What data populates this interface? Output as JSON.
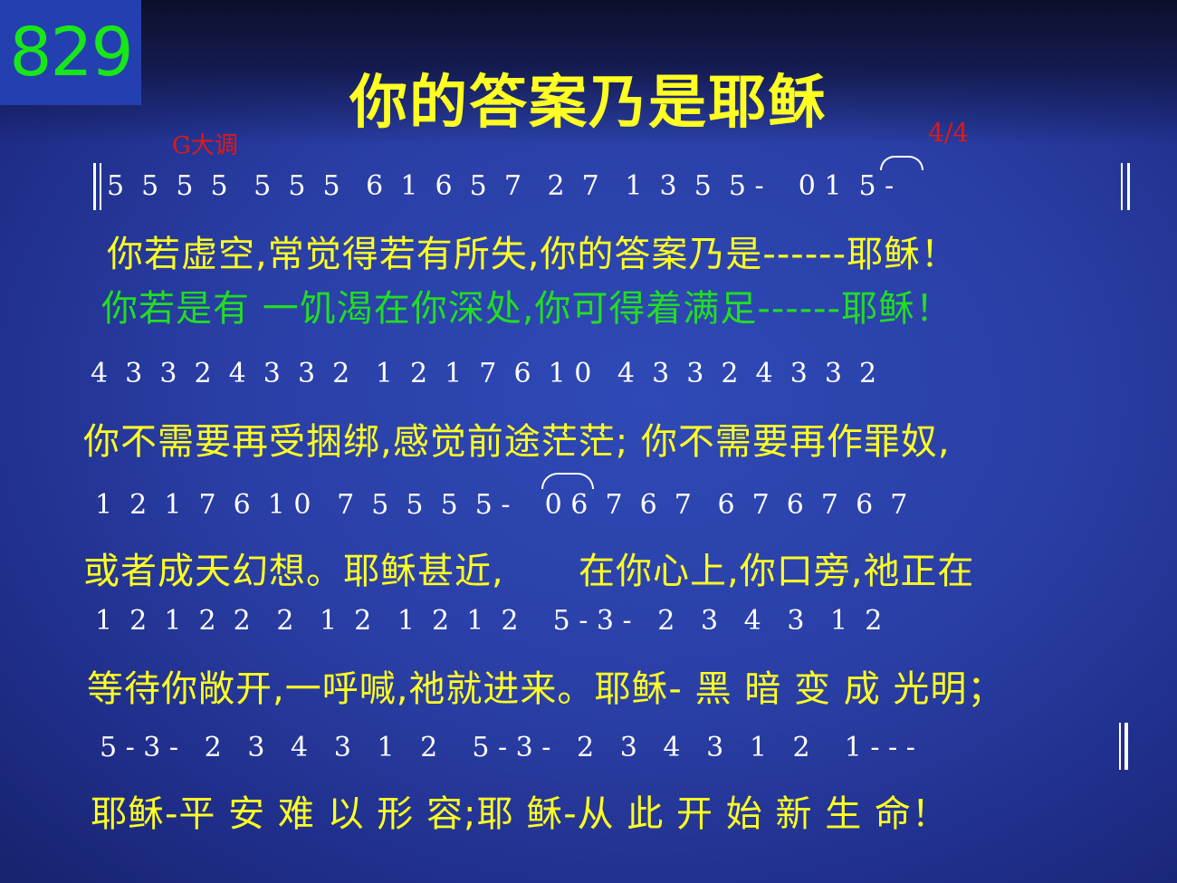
{
  "hymn_number": "829",
  "title": "你的答案乃是耶稣",
  "key": "G大调",
  "meter": "4/4",
  "lines": [
    {
      "notes": "5  5  5  5   5  5  5   6  1  6  5  7   2  7   1  3  5  5 -    0 1  5 -",
      "lyrics1": "你若虚空,常觉得若有所失,你的答案乃是------耶稣！",
      "lyrics2": "你若是有 一饥渴在你深处,你可得着满足------耶稣！"
    },
    {
      "notes": "4  3  3  2  4  3  3  2   1  2  1  7  6  1 0   4  3  3  2  4  3  3  2",
      "lyrics": "你不需要再受捆绑,感觉前途茫茫; 你不需要再作罪奴,"
    },
    {
      "notes": "1  2  1  7  6  1 0   7  5  5  5  5 -    0 6  7  6  7   6  7  6  7  6  7",
      "lyrics": "或者成天幻想。耶稣甚近,      在你心上,你口旁,祂正在"
    },
    {
      "notes": "1  2  1  2  2   2   1  2   1  2  1  2    5 - 3 -   2   3   4   3   1  2",
      "lyrics": "等待你敞开,一呼喊,祂就进来。耶稣- 黑 暗 变 成 光明；"
    },
    {
      "notes": "5 - 3 -   2   3   4   3   1   2    5 - 3 -   2   3   4   3   1   2    1 - - -",
      "lyrics": "耶稣-平 安 难 以 形 容;耶 稣-从 此 开 始 新 生 命！"
    }
  ]
}
